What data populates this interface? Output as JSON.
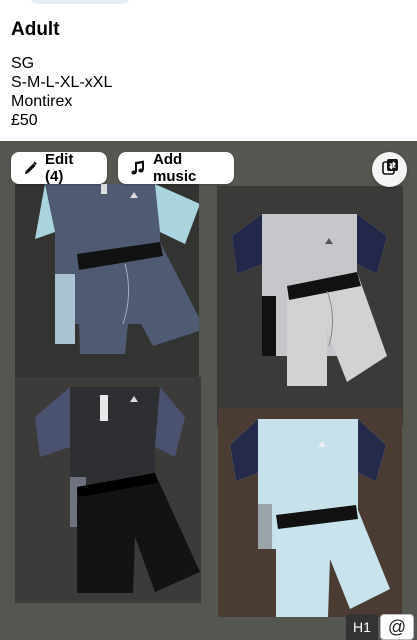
{
  "post": {
    "title": "Adult",
    "lines": [
      "SG",
      "S-M-L-XL-xXL",
      "Montirex",
      "£50"
    ]
  },
  "media_controls": {
    "edit_label": "Edit (4)",
    "music_label": "Add music"
  },
  "icons": {
    "edit": "pencil-icon",
    "music": "music-note-icon",
    "swap": "swap-photos-icon"
  },
  "footer": {
    "heading_badge": "H1",
    "mention_badge": "@"
  },
  "colors": {
    "media_background": "#545750",
    "button_background": "#ffffff"
  }
}
